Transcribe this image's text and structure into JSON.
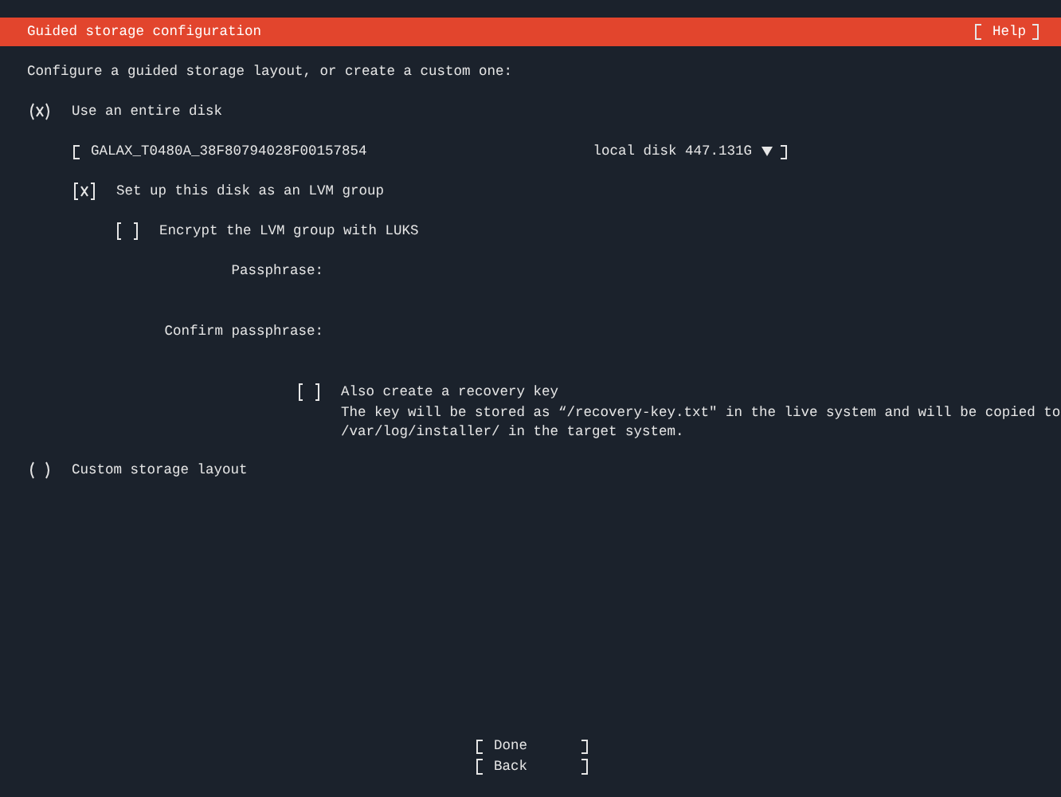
{
  "header": {
    "title": "Guided storage configuration",
    "help_button": "Help"
  },
  "intro": "Configure a guided storage layout, or create a custom one:",
  "entire_disk": {
    "label": "Use an entire disk",
    "selected": true
  },
  "disk_dropdown": {
    "name": "GALAX_T0480A_38F80794028F00157854",
    "size": "local disk 447.131G"
  },
  "lvm": {
    "label": "Set up this disk as an LVM group",
    "checked": true
  },
  "encrypt": {
    "label": "Encrypt the LVM group with LUKS",
    "checked": false
  },
  "passphrase_fields": [
    {
      "label": "Passphrase:"
    },
    {
      "label": "Confirm passphrase:"
    }
  ],
  "recovery": {
    "label": "Also create a recovery key",
    "checked": false,
    "description": [
      "The key will be stored as “/recovery-key.txt\" in the live system and will be copied to",
      "/var/log/installer/ in the target system."
    ]
  },
  "custom_layout": {
    "label": "Custom storage layout",
    "selected": false
  },
  "buttons": [
    {
      "label": "Done"
    },
    {
      "label": "Back"
    }
  ]
}
